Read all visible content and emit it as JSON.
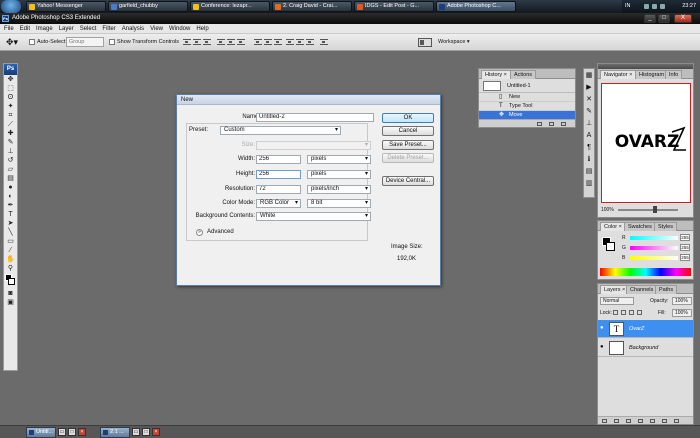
{
  "taskbar": {
    "items": [
      {
        "label": "Yahoo! Messenger",
        "icon": "yahoo-messenger-icon",
        "color": "#f4c20d"
      },
      {
        "label": "garfield_chubby",
        "icon": "image-icon",
        "color": "#4a7cc7"
      },
      {
        "label": "Conference: lezapr...",
        "icon": "yahoo-conference-icon",
        "color": "#f4c20d"
      },
      {
        "label": "2. Craig David - Crai...",
        "icon": "media-player-icon",
        "color": "#e56a1b"
      },
      {
        "label": "IDGS - Edit Post - G...",
        "icon": "firefox-icon",
        "color": "#e5571b"
      },
      {
        "label": "Adobe Photoshop C...",
        "icon": "photoshop-icon",
        "color": "#1c3f7a"
      }
    ],
    "tray": {
      "lang": "IN",
      "clock": "23:27"
    }
  },
  "window": {
    "title": "Adobe Photoshop CS3 Extended",
    "controls": [
      "_",
      "□",
      "X"
    ]
  },
  "menu": [
    "File",
    "Edit",
    "Image",
    "Layer",
    "Select",
    "Filter",
    "Analysis",
    "View",
    "Window",
    "Help"
  ],
  "options": {
    "auto_select_label": "Auto-Select:",
    "auto_select_value": "Group",
    "transform_label": "Show Transform Controls",
    "workspace_label": "Workspace ▾"
  },
  "tools": {
    "badge": "Ps",
    "icons": [
      {
        "name": "move-tool-icon",
        "glyph": "✥"
      },
      {
        "name": "marquee-tool-icon",
        "glyph": "⬚"
      },
      {
        "name": "lasso-tool-icon",
        "glyph": "ʘ"
      },
      {
        "name": "magic-wand-tool-icon",
        "glyph": "✦"
      },
      {
        "name": "crop-tool-icon",
        "glyph": "⌗"
      },
      {
        "name": "slice-tool-icon",
        "glyph": "⟋"
      },
      {
        "name": "healing-brush-tool-icon",
        "glyph": "✚"
      },
      {
        "name": "brush-tool-icon",
        "glyph": "✎"
      },
      {
        "name": "clone-stamp-tool-icon",
        "glyph": "⊥"
      },
      {
        "name": "history-brush-tool-icon",
        "glyph": "↺"
      },
      {
        "name": "eraser-tool-icon",
        "glyph": "▱"
      },
      {
        "name": "gradient-tool-icon",
        "glyph": "▤"
      },
      {
        "name": "blur-tool-icon",
        "glyph": "●"
      },
      {
        "name": "dodge-tool-icon",
        "glyph": "◐"
      },
      {
        "name": "pen-tool-icon",
        "glyph": "✒"
      },
      {
        "name": "type-tool-icon",
        "glyph": "T"
      },
      {
        "name": "path-selection-tool-icon",
        "glyph": "➤"
      },
      {
        "name": "line-tool-icon",
        "glyph": "╲"
      },
      {
        "name": "notes-tool-icon",
        "glyph": "▭"
      },
      {
        "name": "eyedropper-tool-icon",
        "glyph": "⁄"
      },
      {
        "name": "hand-tool-icon",
        "glyph": "✋"
      },
      {
        "name": "zoom-tool-icon",
        "glyph": "⚲"
      }
    ]
  },
  "history": {
    "tabs": [
      "History ×",
      "Actions"
    ],
    "snapshot": "Untitled-1",
    "items": [
      {
        "label": "New",
        "icon": "document-icon",
        "glyph": "▯"
      },
      {
        "label": "Type Tool",
        "icon": "type-icon",
        "glyph": "T"
      },
      {
        "label": "Move",
        "icon": "move-icon",
        "glyph": "✥"
      }
    ]
  },
  "navigator": {
    "tabs": [
      "Navigator ×",
      "Histogram",
      "Info"
    ],
    "zoom": "100%",
    "artwork_text": "OVARZ"
  },
  "color": {
    "tabs": [
      "Color ×",
      "Swatches",
      "Styles"
    ],
    "channels": [
      {
        "label": "R",
        "value": "255",
        "ramp": "#ff2a2a"
      },
      {
        "label": "G",
        "value": "255",
        "ramp": "#d94bd9"
      },
      {
        "label": "B",
        "value": "255",
        "ramp": "#c7c71c"
      }
    ]
  },
  "layers": {
    "tabs": [
      "Layers ×",
      "Channels",
      "Paths"
    ],
    "blend_mode": "Normal",
    "opacity_label": "Opacity:",
    "opacity_value": "100%",
    "lock_label": "Lock:",
    "fill_label": "Fill:",
    "fill_value": "100%",
    "items": [
      {
        "name": "OvarZ",
        "thumb": "T"
      },
      {
        "name": "Background",
        "thumb": ""
      }
    ]
  },
  "dialog": {
    "title": "New",
    "name_label": "Name:",
    "name_value": "Untitled-2",
    "preset_label": "Preset:",
    "preset_value": "Custom",
    "size_label": "Size:",
    "width_label": "Width:",
    "width_value": "256",
    "width_unit": "pixels",
    "height_label": "Height:",
    "height_value": "256",
    "height_unit": "pixels",
    "resolution_label": "Resolution:",
    "resolution_value": "72",
    "resolution_unit": "pixels/inch",
    "mode_label": "Color Mode:",
    "mode_value": "RGB Color",
    "bit_value": "8 bit",
    "bg_label": "Background Contents:",
    "bg_value": "White",
    "advanced_label": "Advanced",
    "image_size_label": "Image Size:",
    "image_size_value": "192,0K",
    "buttons": {
      "ok": "OK",
      "cancel": "Cancel",
      "save_preset": "Save Preset...",
      "delete_preset": "Delete Preset...",
      "device_central": "Device Central..."
    }
  },
  "bottombar": {
    "docs": [
      "Untitl...",
      "2.1 ..."
    ]
  }
}
